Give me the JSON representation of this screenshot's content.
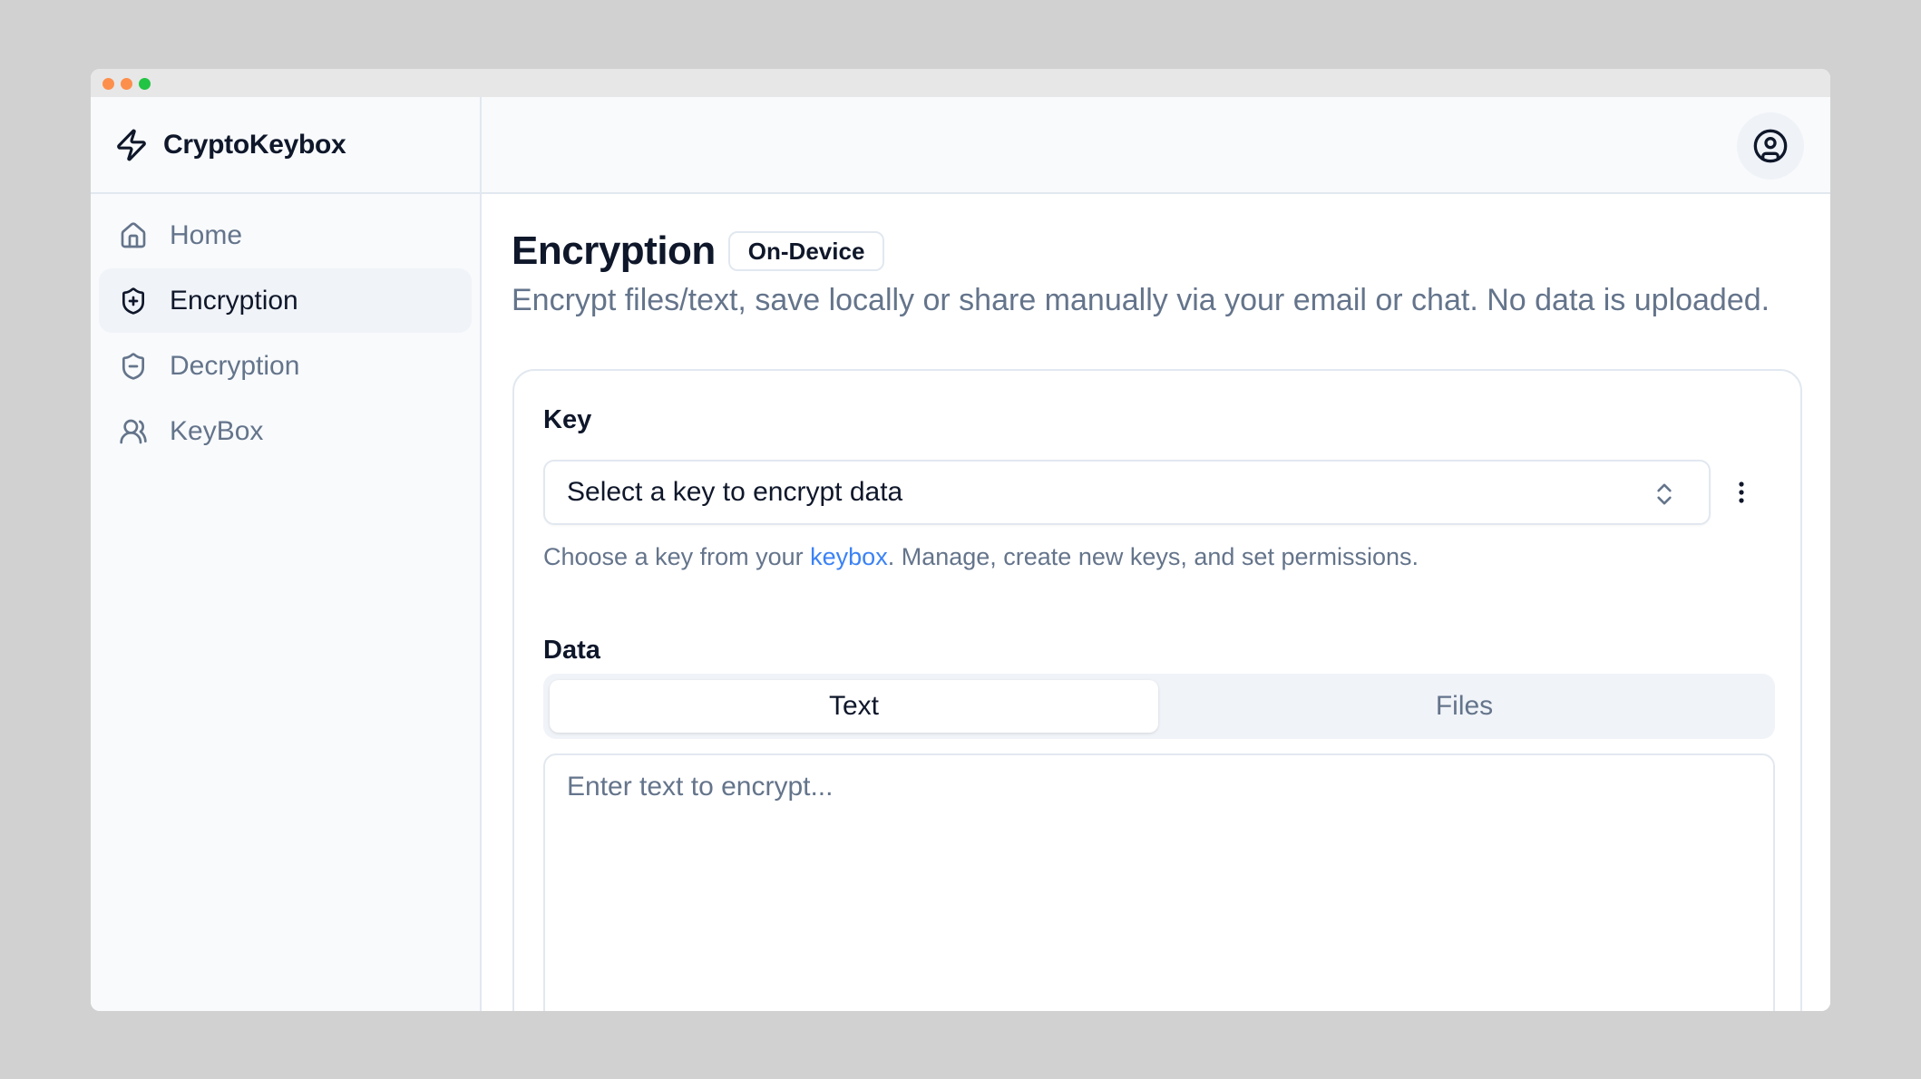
{
  "window": {
    "controls": [
      "close",
      "minimize",
      "maximize"
    ]
  },
  "brand": {
    "name": "CryptoKeybox",
    "icon": "zap-icon"
  },
  "sidebar": {
    "items": [
      {
        "label": "Home",
        "icon": "home-icon",
        "active": false
      },
      {
        "label": "Encryption",
        "icon": "shield-plus-icon",
        "active": true
      },
      {
        "label": "Decryption",
        "icon": "shield-minus-icon",
        "active": false
      },
      {
        "label": "KeyBox",
        "icon": "users-icon",
        "active": false
      }
    ]
  },
  "topbar": {
    "account_icon": "user-circle-icon"
  },
  "page": {
    "title": "Encryption",
    "badge": "On-Device",
    "subtitle": "Encrypt files/text, save locally or share manually via your email or chat. No data is uploaded."
  },
  "key_section": {
    "label": "Key",
    "select_placeholder": "Select a key to encrypt data",
    "help_prefix": "Choose a key from your ",
    "help_link": "keybox",
    "help_suffix": ". Manage, create new keys, and set permissions."
  },
  "data_section": {
    "label": "Data",
    "tabs": [
      {
        "label": "Text",
        "active": true
      },
      {
        "label": "Files",
        "active": false
      }
    ],
    "textarea_placeholder": "Enter text to encrypt...",
    "textarea_value": ""
  },
  "colors": {
    "accent_link": "#3b82f6",
    "text_primary": "#0f172a",
    "text_muted": "#64748b",
    "border": "#e2e8f0",
    "sidebar_bg": "#f8fafc",
    "active_bg": "#f0f3f8"
  }
}
